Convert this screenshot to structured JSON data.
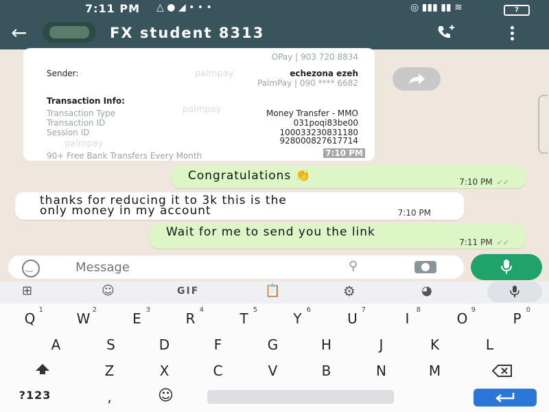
{
  "status_bar": {
    "time": "7:11 PM",
    "battery": "7"
  },
  "header": {
    "title": "FX student 8313"
  },
  "receipt": {
    "opay_line": "OPay | 903 720 8834",
    "sender_label": "Sender:",
    "sender_name": "echezona ezeh",
    "sender_account": "PalmPay | 090 **** 6682",
    "info_heading": "Transaction Info:",
    "rows": [
      {
        "label": "Transaction Type",
        "value": "Money Transfer - MMO"
      },
      {
        "label": "Transaction ID",
        "value": "031poqi83be00"
      },
      {
        "label": "Session ID",
        "value": "100033230831180"
      }
    ],
    "session_cont": "928000827617714",
    "footer": "90+ Free Bank Transfers Every Month",
    "watermark": "palmpay",
    "timestamp": "7:10 PM"
  },
  "messages": [
    {
      "direction": "out",
      "text": "Congratulations 👏",
      "time": "7:10 PM"
    },
    {
      "direction": "in",
      "line1": "thanks for reducing it to 3k this is the",
      "line2": "only money in my account",
      "time": "7:10 PM"
    },
    {
      "direction": "out",
      "text": "Wait for me to send you the link",
      "time": "7:11 PM"
    }
  ],
  "composer": {
    "placeholder": "Message"
  },
  "keyboard": {
    "toolbar_gif": "GIF",
    "row1": [
      "Q",
      "W",
      "E",
      "R",
      "T",
      "Y",
      "U",
      "I",
      "O",
      "P"
    ],
    "row1_hints": [
      "1",
      "2",
      "3",
      "4",
      "5",
      "6",
      "7",
      "8",
      "9",
      "0"
    ],
    "row2": [
      "A",
      "S",
      "D",
      "F",
      "G",
      "H",
      "J",
      "K",
      "L"
    ],
    "row3": [
      "Z",
      "X",
      "C",
      "V",
      "B",
      "N",
      "M"
    ],
    "symbols_key": "?123",
    "comma_key": ","
  },
  "colors": {
    "header_bg": "#39545d",
    "outgoing_bubble": "#dcf7c5",
    "mic_button": "#20a36a",
    "enter_key": "#2a76d9"
  }
}
